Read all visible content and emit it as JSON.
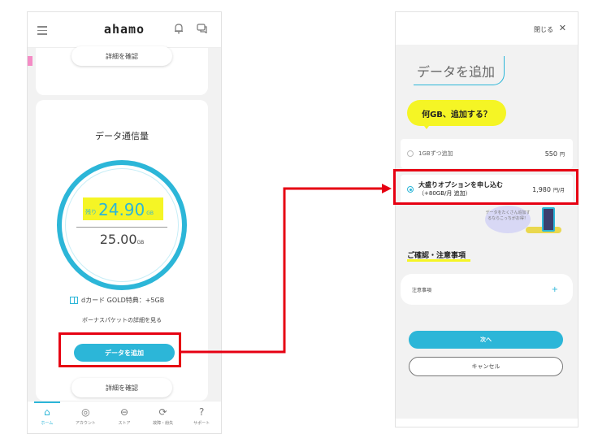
{
  "left": {
    "header": {
      "logo": "ahamo"
    },
    "card_top": {
      "detail_label": "詳細を確認"
    },
    "usage": {
      "title": "データ通信量",
      "remaining_prefix": "残り",
      "remaining_value": "24.90",
      "remaining_unit": "GB",
      "total_value": "25.00",
      "total_unit": "GB",
      "bonus": "dカード GOLD特典：+5GB",
      "bonus_link": "ボーナスパケットの詳細を見る",
      "add_button": "データを追加",
      "detail_label": "詳細を確認"
    },
    "nav": [
      {
        "icon": "home-icon",
        "glyph": "⌂",
        "label": "ホーム"
      },
      {
        "icon": "account-icon",
        "glyph": "◎",
        "label": "アカウント"
      },
      {
        "icon": "store-icon",
        "glyph": "⊖",
        "label": "ストア"
      },
      {
        "icon": "trouble-icon",
        "glyph": "⟳",
        "label": "故障・紛失"
      },
      {
        "icon": "support-icon",
        "glyph": "?",
        "label": "サポート"
      }
    ]
  },
  "right": {
    "close_label": "閉じる",
    "close_glyph": "✕",
    "title": "データを追加",
    "question": "何GB、追加する？",
    "options": [
      {
        "label": "1GBずつ追加",
        "price": "550",
        "unit": "円"
      },
      {
        "label": "大盛りオプションを申し込む",
        "sub": "（+80GB/月 追加）",
        "price": "1,980",
        "unit": "円/月"
      }
    ],
    "promo_text": "データをたくさん追加するならこっちがお得！",
    "notes_heading": "ご確認・注意事項",
    "notes_row": "注意事項",
    "plus": "+",
    "next_button": "次へ",
    "cancel_button": "キャンセル"
  },
  "colors": {
    "accent": "#2cb6d8",
    "highlight": "#f5f525",
    "annotation": "#e60012"
  }
}
